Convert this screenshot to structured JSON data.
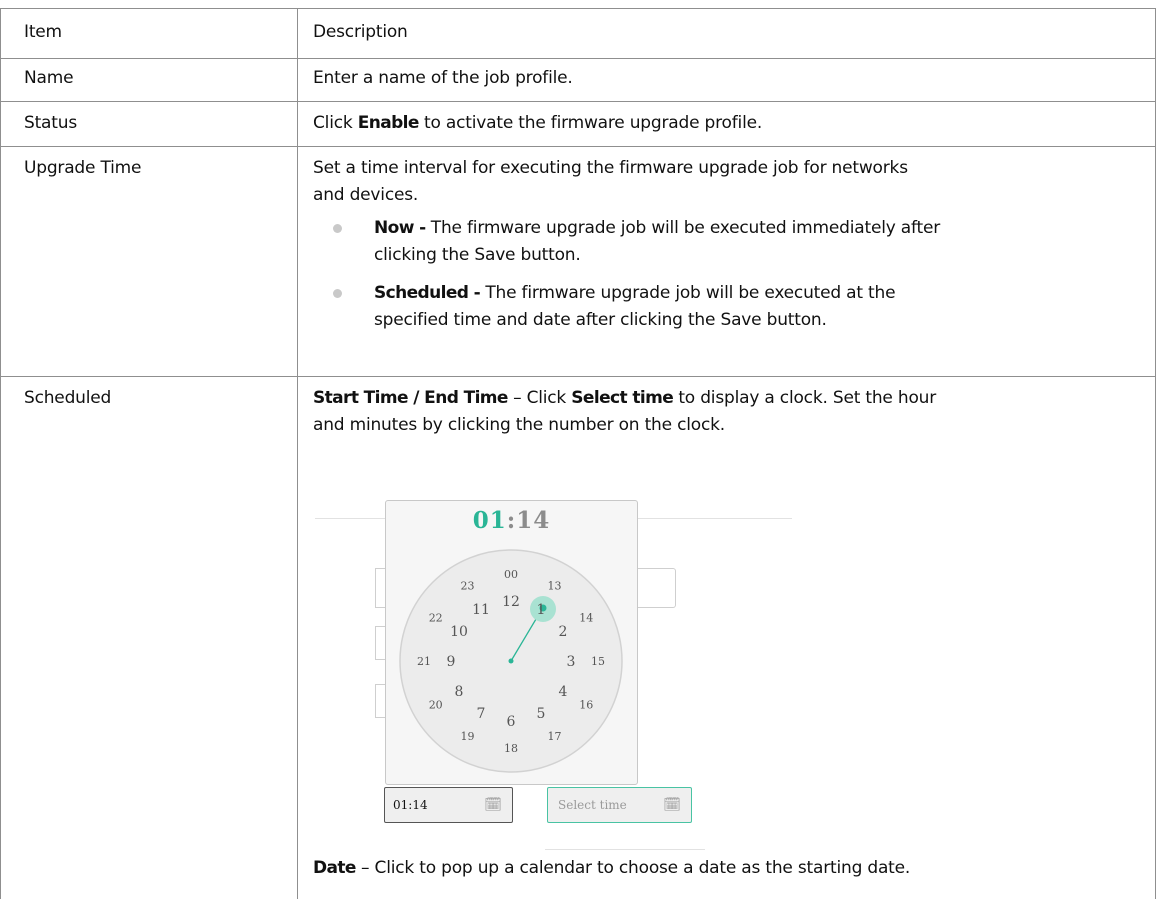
{
  "table": {
    "header": {
      "item": "Item",
      "description": "Description"
    },
    "rows": {
      "name": {
        "item": "Name",
        "description": "Enter a name of the job profile."
      },
      "status": {
        "item": "Status",
        "pre": "Click ",
        "bold": "Enable",
        "post": " to activate the firmware upgrade profile."
      },
      "upgrade_time": {
        "item": "Upgrade Time",
        "line1": "Set a time interval for executing the firmware upgrade job for networks",
        "line2": "and devices.",
        "bullets": [
          {
            "label": "Now -",
            "line1": " The firmware upgrade job will be executed immediately after",
            "line2": "clicking the Save button."
          },
          {
            "label": "Scheduled -",
            "line1": " The firmware upgrade job will be executed at the",
            "line2": "specified time and date after clicking the Save button."
          }
        ]
      },
      "scheduled": {
        "item": "Scheduled",
        "start_end_label": "Start Time / End Time",
        "dash1": " – Click ",
        "select_time_bold": "Select time",
        "text1_rest": " to display a clock. Set the hour",
        "text1_line2": "and minutes by clicking the number on the clock.",
        "date_label": "Date",
        "date_text": " – Click to pop up a calendar to choose a date as the starting date."
      }
    }
  },
  "clock": {
    "hours": "01",
    "separator": ":",
    "minutes": "14",
    "dial_outer": [
      "00",
      "13",
      "14",
      "15",
      "16",
      "17",
      "18",
      "19",
      "20",
      "21",
      "22",
      "23"
    ],
    "dial_inner": [
      "12",
      "1",
      "2",
      "3",
      "4",
      "5",
      "6",
      "7",
      "8",
      "9",
      "10",
      "11"
    ],
    "start_input_value": "01:14",
    "end_input_placeholder": "Select time",
    "calendar_icon": "calendar-icon",
    "accent_color": "#2ab596"
  }
}
